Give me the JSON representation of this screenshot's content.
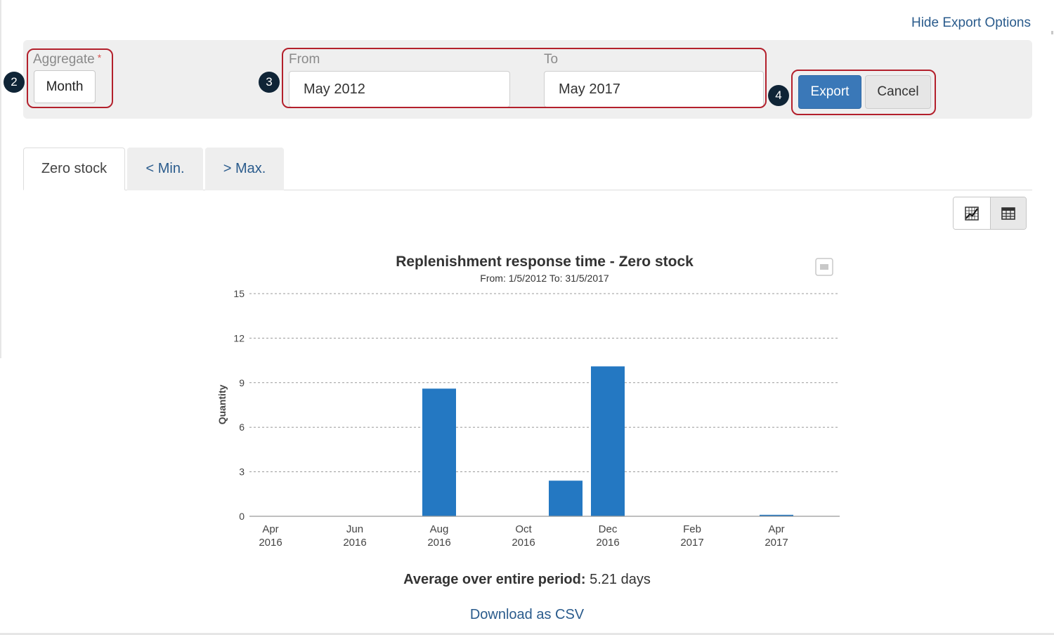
{
  "header": {
    "hide_export_label": "Hide Export Options"
  },
  "export_options": {
    "aggregate_label": "Aggregate",
    "required_mark": "*",
    "aggregate_value": "Month",
    "from_label": "From",
    "from_value": "May 2012",
    "to_label": "To",
    "to_value": "May 2017",
    "export_button": "Export",
    "cancel_button": "Cancel"
  },
  "callouts": [
    "2",
    "3",
    "4"
  ],
  "tabs": [
    {
      "label": "Zero stock",
      "active": true
    },
    {
      "label": "< Min.",
      "active": false
    },
    {
      "label": "> Max.",
      "active": false
    }
  ],
  "view_toggle": {
    "chart_icon": "chart-icon",
    "table_icon": "table-icon",
    "selected": "chart"
  },
  "chart_data": {
    "type": "bar",
    "title": "Replenishment response time - Zero stock",
    "subtitle": "From: 1/5/2012 To: 31/5/2017",
    "ylabel": "Quantity",
    "xlabel": "",
    "ylim": [
      0,
      15
    ],
    "yticks": [
      0,
      3,
      6,
      9,
      12,
      15
    ],
    "grid": true,
    "categories": [
      "Apr 2016",
      "May 2016",
      "Jun 2016",
      "Jul 2016",
      "Aug 2016",
      "Sep 2016",
      "Oct 2016",
      "Nov 2016",
      "Dec 2016",
      "Jan 2017",
      "Feb 2017",
      "Mar 2017",
      "Apr 2017"
    ],
    "xtick_labels": [
      {
        "month": "Apr",
        "year": "2016"
      },
      {
        "month": "Jun",
        "year": "2016"
      },
      {
        "month": "Aug",
        "year": "2016"
      },
      {
        "month": "Oct",
        "year": "2016"
      },
      {
        "month": "Dec",
        "year": "2016"
      },
      {
        "month": "Feb",
        "year": "2017"
      },
      {
        "month": "Apr",
        "year": "2017"
      }
    ],
    "values": [
      0,
      0,
      0,
      0,
      8.6,
      0,
      0,
      2.4,
      10.1,
      0,
      0,
      0,
      0.1
    ],
    "bar_color": "#2478c2"
  },
  "summary": {
    "average_label": "Average over entire period:",
    "average_value": "5.21 days",
    "download_label": "Download as CSV"
  }
}
